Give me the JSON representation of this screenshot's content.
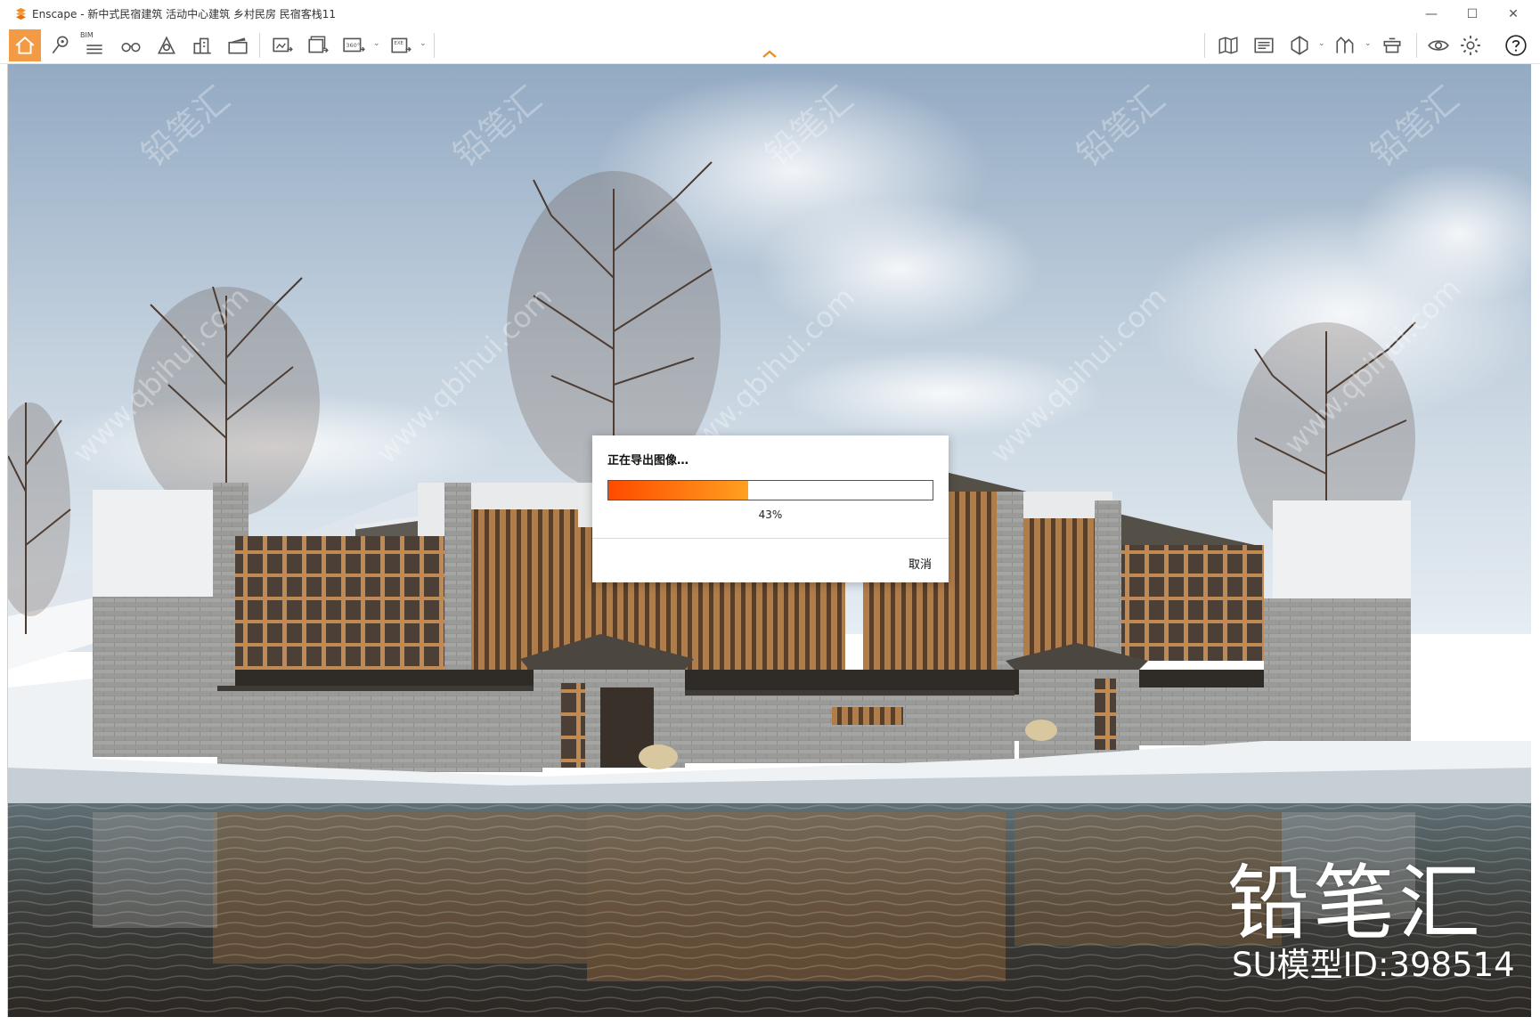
{
  "window": {
    "title": "Enscape - 新中式民宿建筑 活动中心建筑 乡村民房 民宿客栈11",
    "controls": {
      "minimize": "—",
      "maximize": "☐",
      "close": "✕"
    }
  },
  "toolbar": {
    "bim_label": "BIM",
    "pano_label": "360°",
    "exe_label": "EXE",
    "dropdown_glyph": "⌄",
    "left_tools": [
      "home-icon",
      "location-pin-icon",
      "bim-icon",
      "binoculars-icon",
      "atmosphere-icon",
      "asset-library-icon",
      "video-editor-icon",
      "screenshot-icon",
      "batch-render-icon",
      "panorama-360-icon",
      "exe-export-icon"
    ],
    "right_tools": [
      "map-icon",
      "view-management-icon",
      "section-icon",
      "visual-settings-icon",
      "capture-icon",
      "eye-icon",
      "settings-gear-icon",
      "help-icon"
    ],
    "accent_color": "#f39a45"
  },
  "dialog": {
    "title": "正在导出图像…",
    "progress": 0.43,
    "progress_text": "43%",
    "cancel_label": "取消"
  },
  "watermark": {
    "brand": "铅笔汇",
    "model_id": "SU模型ID:398514",
    "url": "www.qbihui.com",
    "brand_small": "铅笔汇"
  }
}
